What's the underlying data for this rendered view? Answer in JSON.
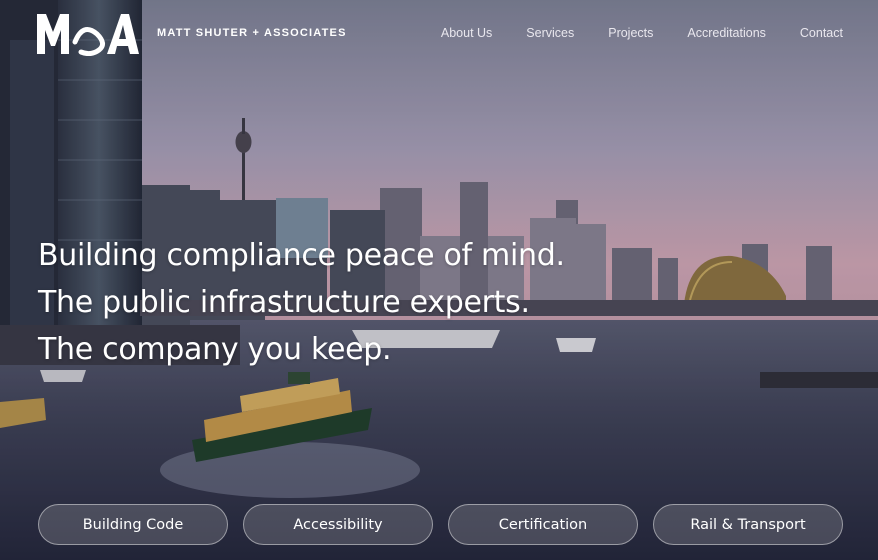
{
  "header": {
    "logo_text": "M&A",
    "brand_name": "MATT SHUTER + ASSOCIATES"
  },
  "nav": {
    "items": [
      "About Us",
      "Services",
      "Projects",
      "Accreditations",
      "Contact"
    ]
  },
  "hero": {
    "headline_lines": [
      "Building compliance peace of mind.",
      "The public infrastructure experts.",
      "The company you keep."
    ]
  },
  "categories": [
    "Building Code",
    "Accessibility",
    "Certification",
    "Rail & Transport"
  ],
  "colors": {
    "sky_top": "#8c8ea3",
    "sky_bottom": "#c9a3b2",
    "water": "#3a3e52",
    "text": "#ffffff"
  }
}
